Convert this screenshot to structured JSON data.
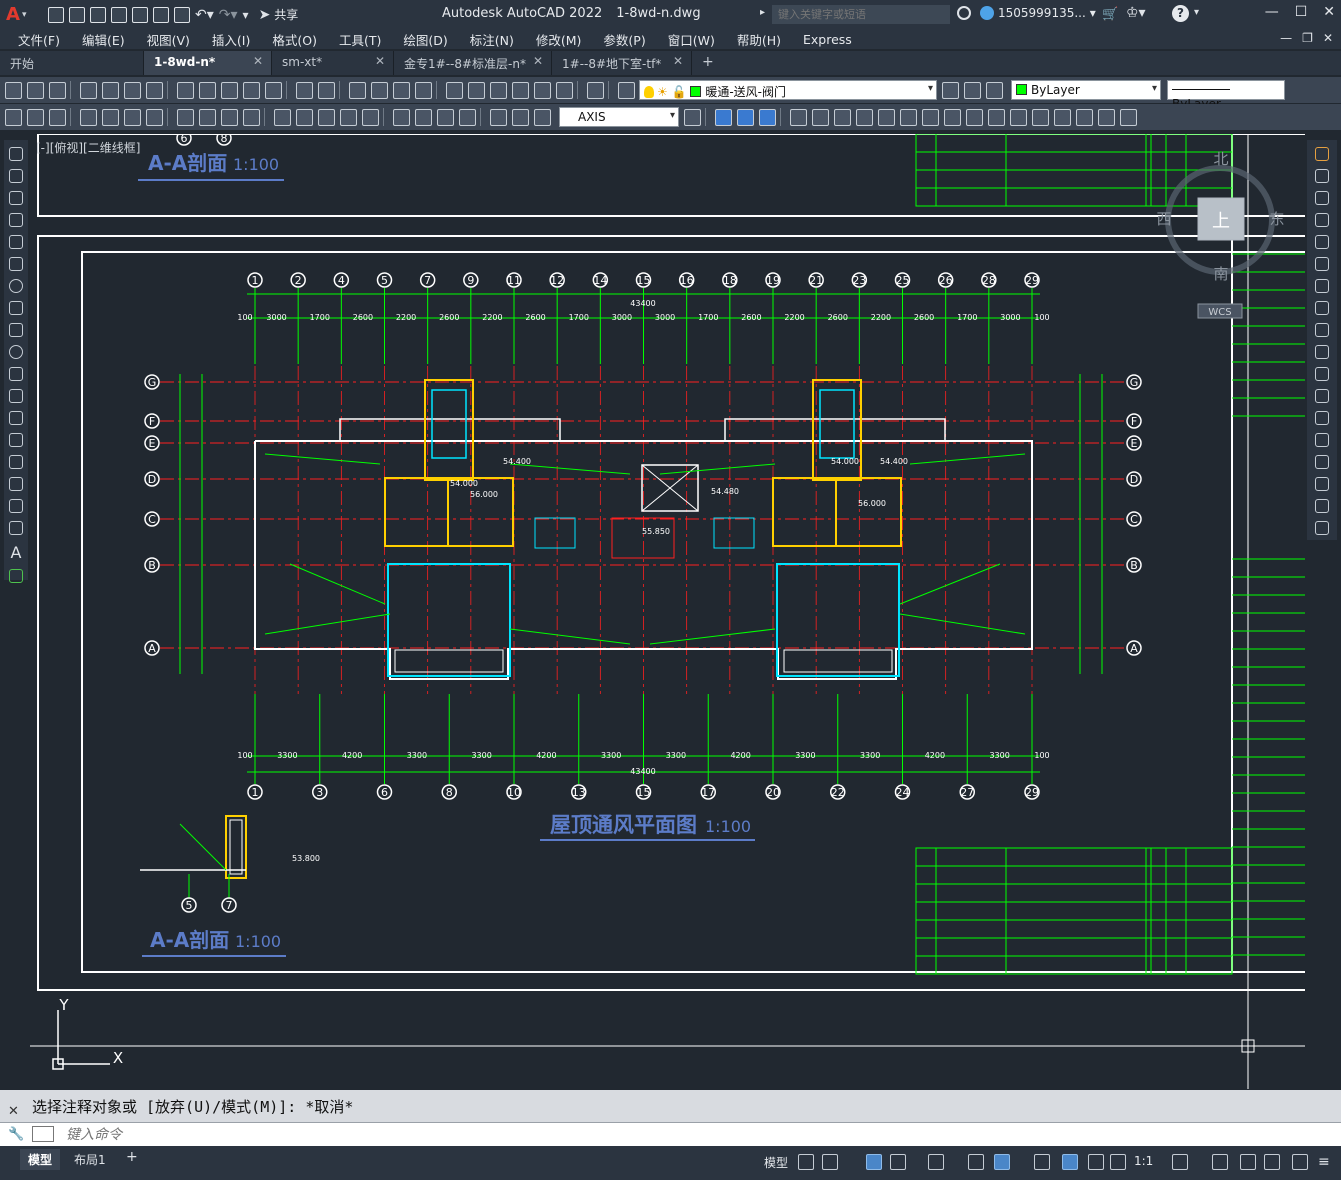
{
  "app": {
    "title": "Autodesk AutoCAD 2022",
    "filename": "1-8wd-n.dwg",
    "search_placeholder": "键入关键字或短语",
    "user": "1505999135...",
    "share": "共享"
  },
  "menu": [
    "文件(F)",
    "编辑(E)",
    "视图(V)",
    "插入(I)",
    "格式(O)",
    "工具(T)",
    "绘图(D)",
    "标注(N)",
    "修改(M)",
    "参数(P)",
    "窗口(W)",
    "帮助(H)",
    "Express"
  ],
  "tabs": [
    {
      "label": "开始",
      "closable": false,
      "active": false
    },
    {
      "label": "1-8wd-n*",
      "closable": true,
      "active": true
    },
    {
      "label": "sm-xt*",
      "closable": true,
      "active": false
    },
    {
      "label": "金专1#--8#标准层-n*",
      "closable": true,
      "active": false
    },
    {
      "label": "1#--8#地下室-tf*",
      "closable": true,
      "active": false
    }
  ],
  "toolbar": {
    "layer": "暖通-送风-阀门",
    "color": "ByLayer",
    "linetype": "ByLayer",
    "dimstyle": "AXIS"
  },
  "viewport": {
    "label": "[-][俯视][二维线框]",
    "compass": {
      "n": "北",
      "s": "南",
      "e": "东",
      "w": "西",
      "center": "上",
      "wcs": "WCS"
    },
    "ucs": {
      "x": "X",
      "y": "Y"
    }
  },
  "drawing": {
    "plan_title": "屋顶通风平面图",
    "plan_scale": "1:100",
    "section_title": "A-A剖面",
    "section_scale": "1:100",
    "total_width": "43400",
    "top_axes": [
      "1",
      "2",
      "4",
      "5",
      "7",
      "9",
      "11",
      "12",
      "14",
      "15",
      "16",
      "18",
      "19",
      "21",
      "23",
      "25",
      "26",
      "28",
      "29"
    ],
    "bottom_axes": [
      "1",
      "3",
      "6",
      "8",
      "10",
      "13",
      "15",
      "17",
      "20",
      "22",
      "24",
      "27",
      "29"
    ],
    "row_axes": [
      "G",
      "F",
      "E",
      "D",
      "C",
      "B",
      "A"
    ],
    "top_dims": [
      "100",
      "3000",
      "1700",
      "2600",
      "2200",
      "2600",
      "2200",
      "2600",
      "1700",
      "3000",
      "3000",
      "1700",
      "2600",
      "2200",
      "2600",
      "2200",
      "2600",
      "1700",
      "3000",
      "100"
    ],
    "bottom_dims": [
      "100",
      "3300",
      "4200",
      "3300",
      "3300",
      "4200",
      "3300",
      "3300",
      "4200",
      "3300",
      "3300",
      "4200",
      "3300",
      "100"
    ],
    "elevations": [
      "54.000",
      "54.400",
      "56.000",
      "54.480",
      "55.850",
      "53.800"
    ],
    "section_axes": [
      "5",
      "7"
    ],
    "section_top_axes": [
      "6",
      "8"
    ]
  },
  "command": {
    "history": "选择注释对象或 [放弃(U)/模式(M)]: *取消*",
    "placeholder": "键入命令"
  },
  "status": {
    "layouts": [
      "模型",
      "布局1"
    ],
    "model_label": "模型",
    "scale": "1:1"
  },
  "colors": {
    "bg": "#212830",
    "chrome": "#2b3440",
    "toolbar": "#3b4553",
    "wall": "#ffffff",
    "axis": "#00ff00",
    "centerline": "#ff2020",
    "duct": "#ffd000",
    "cyan": "#00e5ff",
    "title": "#5c7cc8"
  }
}
